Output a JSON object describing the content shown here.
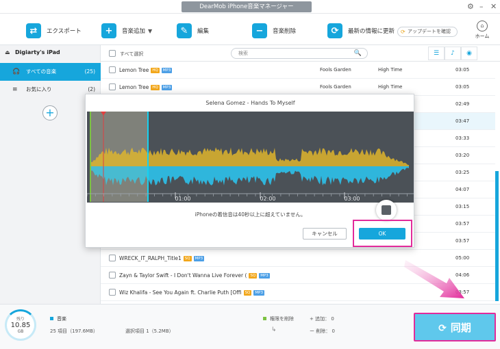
{
  "app": {
    "title": "DearMob iPhone音楽マネージャー"
  },
  "toolbar": {
    "export": "エクスポート",
    "add_music": "音楽追加",
    "edit": "編集",
    "delete_music": "音楽削除",
    "refresh": "最新の情報に更新",
    "update_check": "アップデートを確認",
    "home": "ホーム"
  },
  "sidebar": {
    "device": "Digiarty's iPad",
    "items": [
      {
        "label": "すべての音楽",
        "count": "(25)"
      },
      {
        "label": "お気に入り",
        "count": "(2)"
      }
    ]
  },
  "list": {
    "select_all": "すべて選択",
    "search_placeholder": "検索",
    "rows": [
      {
        "title": "Lemon Tree",
        "badges": [
          "HQ",
          "MP3"
        ],
        "artist": "Fools Garden",
        "album": "High Time",
        "duration": "03:05",
        "selected": false
      },
      {
        "title": "Lemon Tree",
        "badges": [
          "HQ",
          "MP3"
        ],
        "artist": "Fools Garden",
        "album": "High Time",
        "duration": "03:05",
        "selected": false
      },
      {
        "title": "",
        "badges": [],
        "artist": "",
        "album": "",
        "duration": "02:49",
        "selected": false
      },
      {
        "title": "",
        "badges": [],
        "artist": "",
        "album": "",
        "duration": "03:47",
        "selected": true
      },
      {
        "title": "",
        "badges": [],
        "artist": "",
        "album": "",
        "duration": "03:33",
        "selected": false
      },
      {
        "title": "",
        "badges": [],
        "artist": "",
        "album": "",
        "duration": "03:20",
        "selected": false
      },
      {
        "title": "",
        "badges": [],
        "artist": "",
        "album": "",
        "duration": "03:25",
        "selected": false
      },
      {
        "title": "",
        "badges": [],
        "artist": "",
        "album": "",
        "duration": "04:07",
        "selected": false
      },
      {
        "title": "",
        "badges": [],
        "artist": "",
        "album": "",
        "duration": "03:15",
        "selected": false
      },
      {
        "title": "",
        "badges": [],
        "artist": "",
        "album": "",
        "duration": "03:57",
        "selected": false
      },
      {
        "title": "",
        "badges": [],
        "artist": "",
        "album": "",
        "duration": "03:57",
        "selected": false
      },
      {
        "title": "WRECK_IT_RALPH_Title1",
        "badges": [
          "SQ",
          "MP3"
        ],
        "artist": "",
        "album": "",
        "duration": "05:00",
        "selected": false
      },
      {
        "title": "Zayn & Taylor Swift - I Don't Wanna Live Forever (",
        "badges": [
          "SQ",
          "MP3"
        ],
        "artist": "",
        "album": "",
        "duration": "04:06",
        "selected": false
      },
      {
        "title": "Wiz Khalifa - See You Again ft. Charlie Puth [Offi",
        "badges": [
          "SQ",
          "MP3"
        ],
        "artist": "",
        "album": "",
        "duration": "03:57",
        "selected": false
      }
    ]
  },
  "footer": {
    "storage_label": "残り",
    "storage_value": "10.85",
    "storage_unit": "GB",
    "music_label": "音楽",
    "music_total": "25 項目（197.6MB）",
    "music_selected": "選択項目 1（5.2MB）",
    "pending_delete": "権限を削除",
    "add_count": "+ 追加： 0",
    "del_count": "ー 削除： 0",
    "sync": "同期"
  },
  "dialog": {
    "title": "Selena Gomez - Hands To Myself",
    "time_labels": [
      "01:00",
      "02:00",
      "03:00"
    ],
    "message": "iPhoneの着信音は40秒以上に超えていません。",
    "cancel": "キャンセル",
    "ok": "OK"
  },
  "colors": {
    "accent": "#16a6dc",
    "highlight": "#e22a9a",
    "wave_yellow": "#c8a532",
    "wave_blue": "#2fb6dc"
  }
}
